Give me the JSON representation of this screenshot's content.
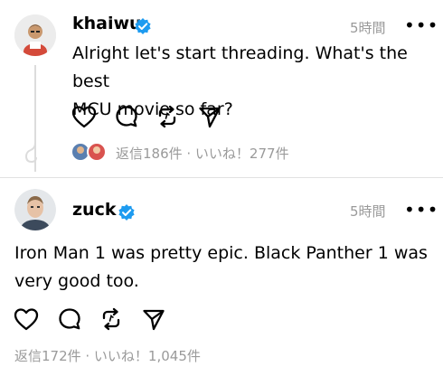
{
  "posts": [
    {
      "username": "khaiwu",
      "verified": true,
      "time": "5時間",
      "text_lines": [
        "Alright let's start threading. What's the best",
        "MCU movie so far?"
      ],
      "stats": "返信186件 · いいね！277件"
    },
    {
      "username": "zuck",
      "verified": true,
      "time": "5時間",
      "text_lines": [
        "Iron Man 1 was pretty epic. Black Panther 1 was",
        "very good too."
      ],
      "stats": "返信172件 · いいね！1,045件"
    }
  ],
  "more_glyph": "•••",
  "icons": {
    "like": "heart-icon",
    "comment": "comment-bubble-icon",
    "repost": "repost-icon",
    "share": "send-icon",
    "verified": "verified-badge-icon",
    "more": "more-icon"
  },
  "colors": {
    "verified": "#1d9bf0",
    "muted_text": "#9a9a9a",
    "thread_line": "#dcdcdc",
    "divider": "#e2e2e2"
  }
}
